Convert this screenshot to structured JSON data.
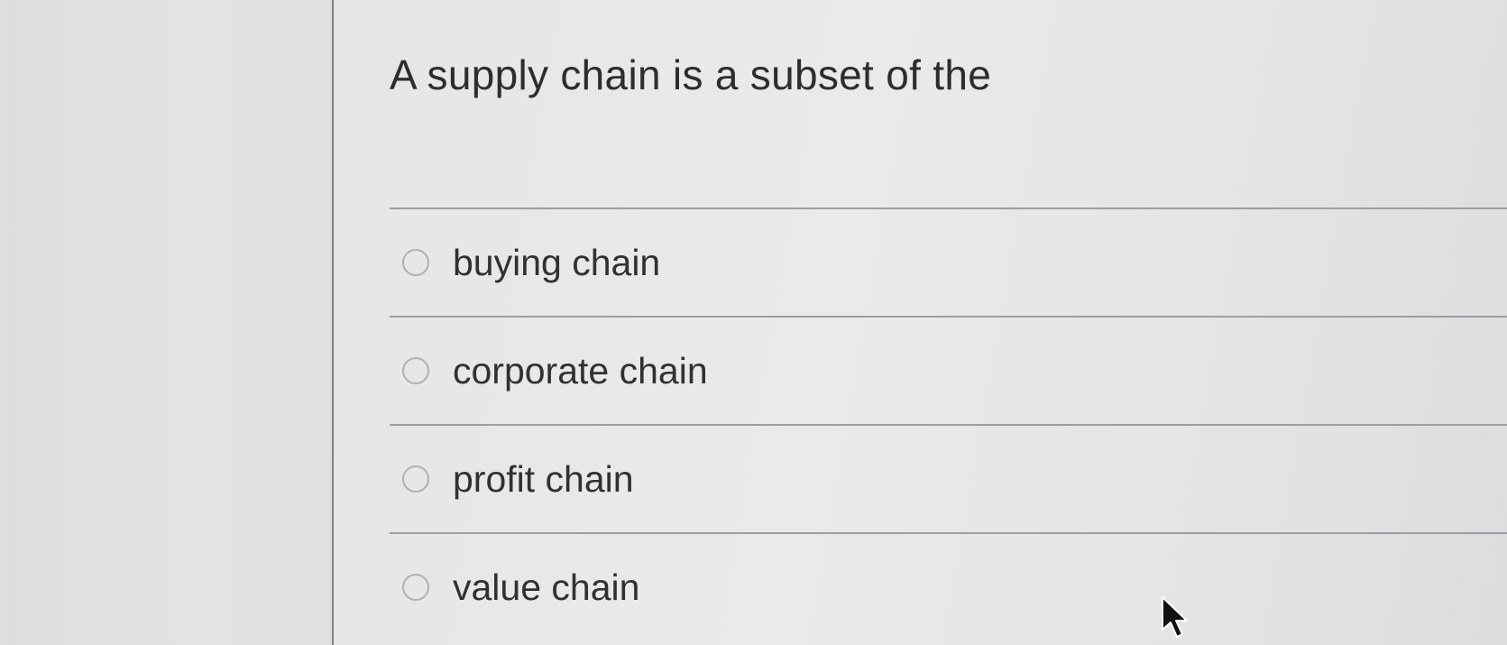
{
  "question": {
    "text": "A supply chain is a subset of the"
  },
  "options": [
    {
      "label": "buying chain",
      "selected": false
    },
    {
      "label": "corporate chain",
      "selected": false
    },
    {
      "label": "profit chain",
      "selected": false
    },
    {
      "label": "value chain",
      "selected": false
    }
  ],
  "cursor": {
    "icon": "arrow-pointer-icon"
  },
  "colors": {
    "background": "#e6e8e6",
    "text": "#2b2d2e",
    "divider": "#9c9fa0"
  }
}
